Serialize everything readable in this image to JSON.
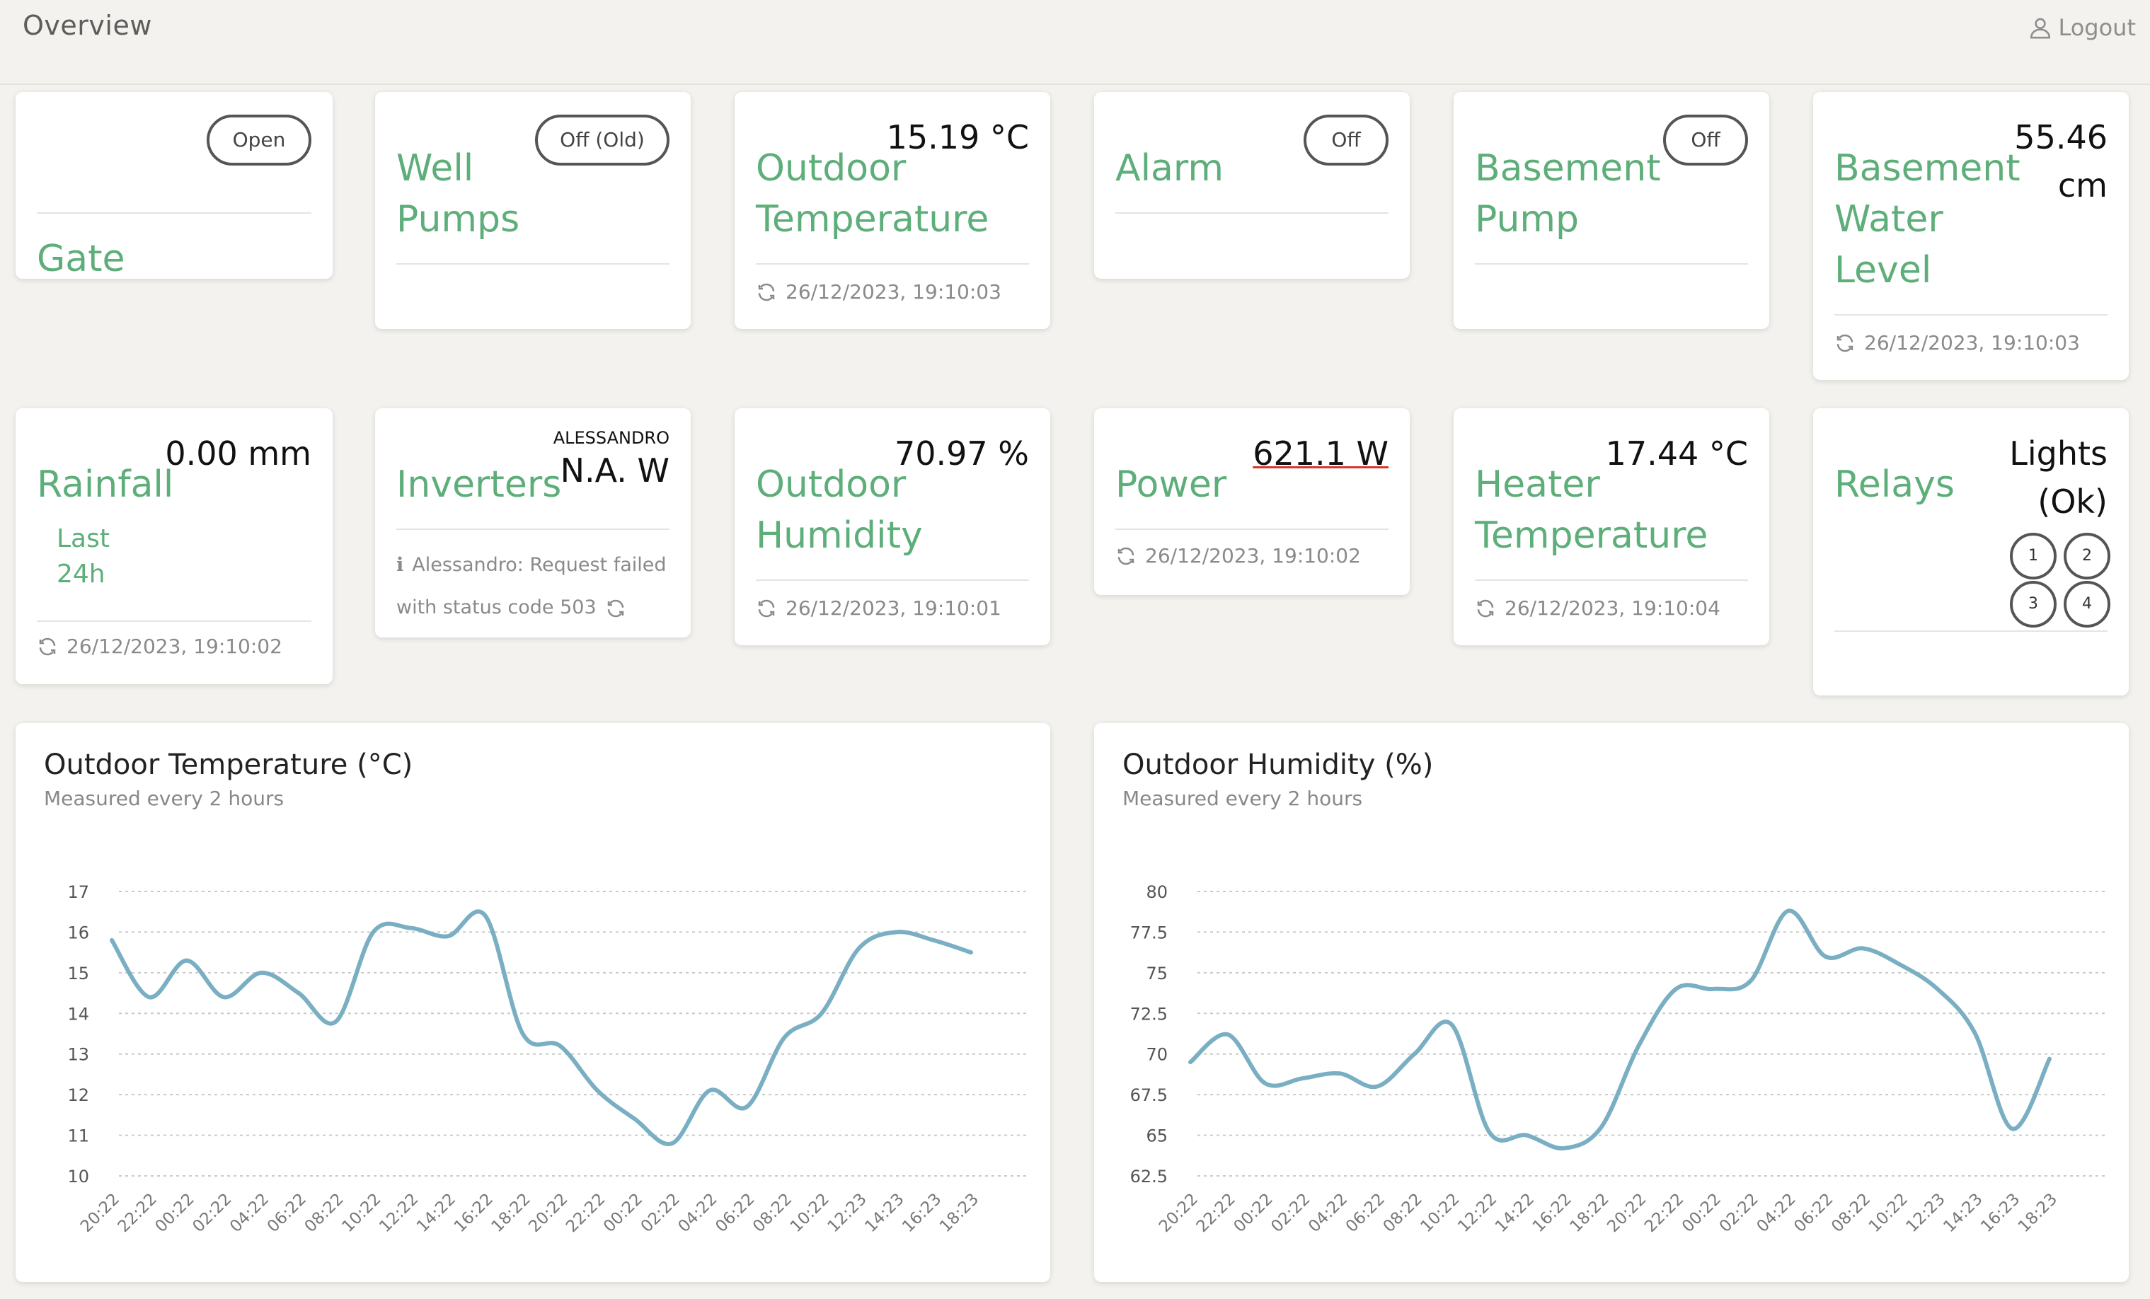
{
  "header": {
    "title": "Overview",
    "logout": "Logout"
  },
  "colors": {
    "accent_green": "#5eae7a",
    "line": "#7aafc3",
    "error_underline": "#d9332b"
  },
  "cards_row1": [
    {
      "title": "Gate",
      "status": "Open"
    },
    {
      "title": "Well Pumps",
      "status": "Off (Old)"
    },
    {
      "title": "Outdoor Temperature",
      "value": "15.19 °C",
      "updated": "26/12/2023, 19:10:03"
    },
    {
      "title": "Alarm",
      "status": "Off"
    },
    {
      "title": "Basement Pump",
      "status": "Off"
    },
    {
      "title": "Basement Water Level",
      "value": "55.46 cm",
      "updated": "26/12/2023, 19:10:03"
    }
  ],
  "cards_row2": [
    {
      "title": "Rainfall",
      "subtitle": "Last 24h",
      "value": "0.00 mm",
      "updated": "26/12/2023, 19:10:02"
    },
    {
      "title": "Inverters",
      "label": "ALESSANDRO",
      "value": "N.A. W",
      "error": "Alessandro: Request failed with status code 503"
    },
    {
      "title": "Outdoor Humidity",
      "value": "70.97 %",
      "updated": "26/12/2023, 19:10:01"
    },
    {
      "title": "Power",
      "value": "621.1 W",
      "updated": "26/12/2023, 19:10:02"
    },
    {
      "title": "Heater Temperature",
      "value": "17.44 °C",
      "updated": "26/12/2023, 19:10:04"
    },
    {
      "title": "Relays",
      "value": "Lights (Ok)",
      "relays": [
        "1",
        "2",
        "3",
        "4"
      ]
    }
  ],
  "chart_data": [
    {
      "type": "line",
      "title": "Outdoor Temperature (°C)",
      "subtitle": "Measured every 2 hours",
      "ylim": [
        10,
        17
      ],
      "yticks": [
        "17",
        "16",
        "15",
        "14",
        "13",
        "12",
        "11",
        "10"
      ],
      "x": [
        "20:22",
        "22:22",
        "00:22",
        "02:22",
        "04:22",
        "06:22",
        "08:22",
        "10:22",
        "12:22",
        "14:22",
        "16:22",
        "18:22",
        "20:22",
        "22:22",
        "00:22",
        "02:22",
        "04:22",
        "06:22",
        "08:22",
        "10:22",
        "12:23",
        "14:23",
        "16:23",
        "18:23"
      ],
      "values": [
        15.8,
        14.4,
        15.3,
        14.4,
        15.0,
        14.5,
        13.8,
        16.0,
        16.1,
        15.9,
        16.4,
        13.5,
        13.2,
        12.1,
        11.4,
        10.8,
        12.1,
        11.7,
        13.4,
        14.0,
        15.6,
        16.0,
        15.8,
        15.5
      ],
      "grid": true
    },
    {
      "type": "line",
      "title": "Outdoor Humidity (%)",
      "subtitle": "Measured every 2 hours",
      "ylim": [
        62.5,
        80
      ],
      "yticks": [
        "80",
        "77.5",
        "75",
        "72.5",
        "70",
        "67.5",
        "65",
        "62.5"
      ],
      "x": [
        "20:22",
        "22:22",
        "00:22",
        "02:22",
        "04:22",
        "06:22",
        "08:22",
        "10:22",
        "12:22",
        "14:22",
        "16:22",
        "18:22",
        "20:22",
        "22:22",
        "00:22",
        "02:22",
        "04:22",
        "06:22",
        "08:22",
        "10:22",
        "12:23",
        "14:23",
        "16:23",
        "18:23"
      ],
      "values": [
        69.5,
        71.2,
        68.2,
        68.5,
        68.8,
        68.0,
        70.0,
        71.8,
        65.2,
        65.0,
        64.2,
        65.5,
        70.5,
        74.0,
        74.0,
        74.5,
        78.8,
        76.0,
        76.5,
        75.5,
        74.0,
        71.3,
        65.4,
        69.7
      ],
      "grid": true
    }
  ]
}
